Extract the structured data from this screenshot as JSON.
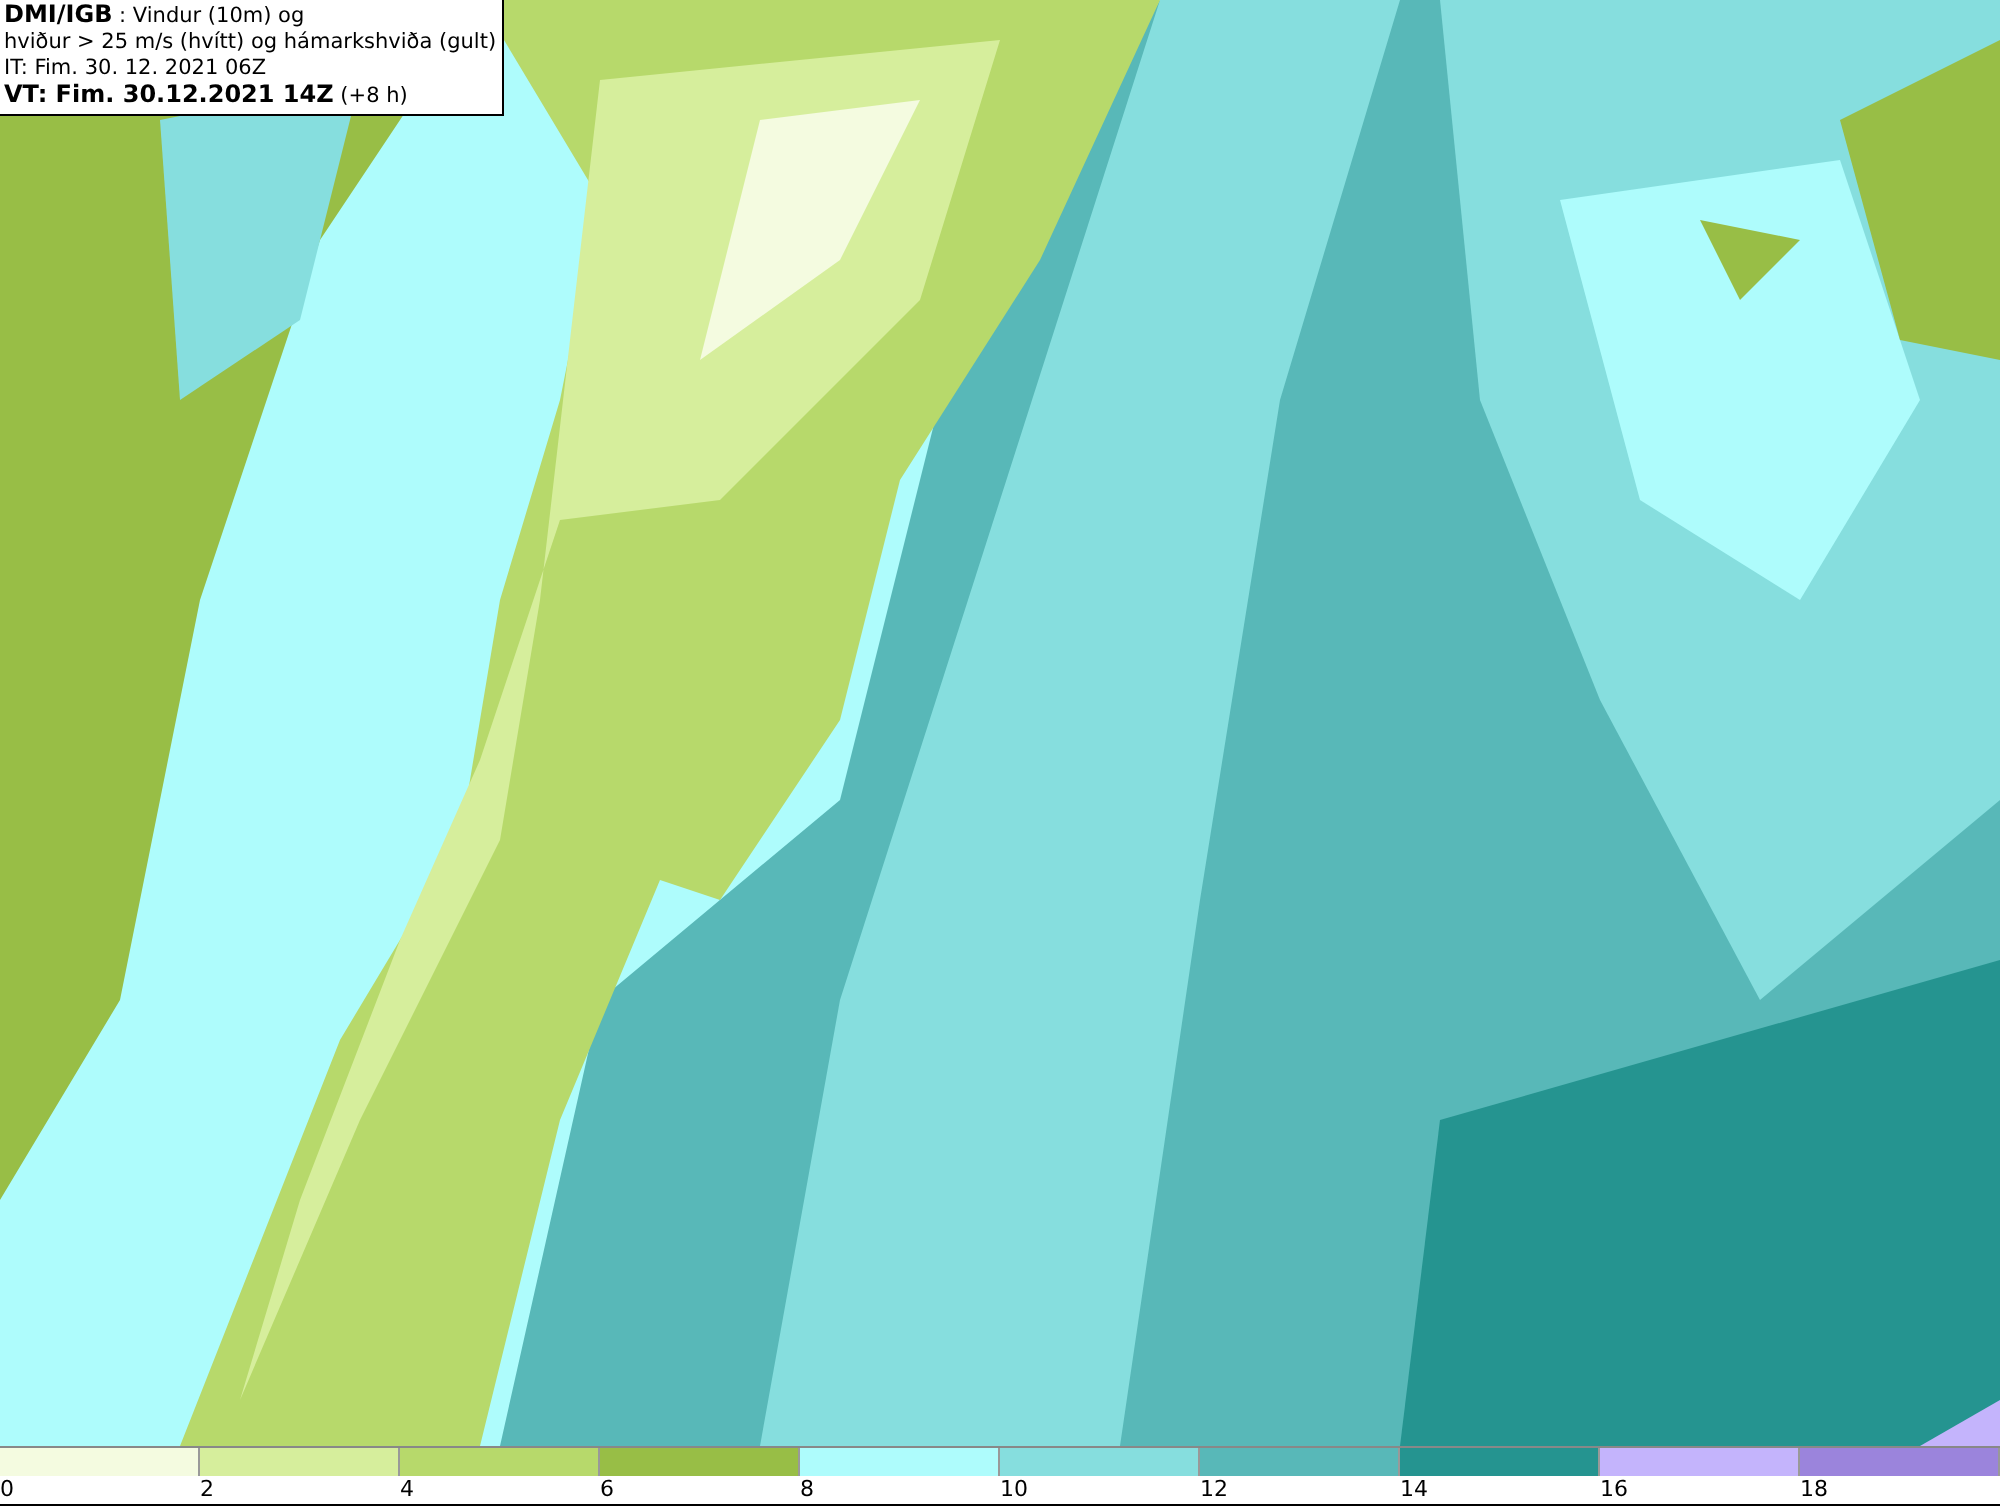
{
  "header": {
    "lines": [
      "**DMI/IGB** : Vindur (10m) og",
      "hviður > 25 m/s (hvítt) og hámarkshviða (gult)",
      "IT: Fim. 30. 12. 2021 06Z",
      "**VT: Fim. 30.12.2021 14Z** (+8 h)"
    ]
  },
  "legend": [
    {
      "label": "0",
      "color": "#f4fbe0"
    },
    {
      "label": "2",
      "color": "#d6ee9c"
    },
    {
      "label": "4",
      "color": "#b7d96b"
    },
    {
      "label": "6",
      "color": "#98be46"
    },
    {
      "label": "8",
      "color": "#aefcfc"
    },
    {
      "label": "10",
      "color": "#86dede"
    },
    {
      "label": "12",
      "color": "#58b8b8"
    },
    {
      "label": "14",
      "color": "#259490"
    },
    {
      "label": "16",
      "color": "#c4b4fc"
    },
    {
      "label": "18",
      "color": "#9b84dc"
    }
  ]
}
